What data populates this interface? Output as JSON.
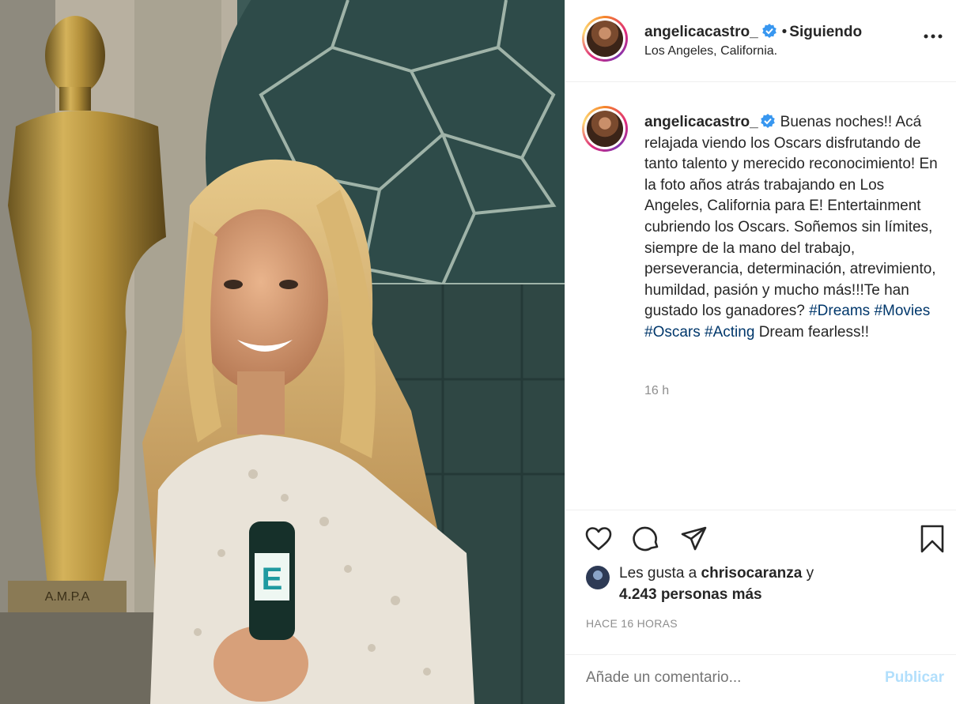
{
  "post": {
    "image_icon": "photo-woman-with-microphone-and-oscar-statue",
    "mic_badge": "E",
    "statue_plaque": "A.M.P.A"
  },
  "header": {
    "username": "angelicacastro_",
    "verified_icon": "verified-badge-icon",
    "separator": "•",
    "follow_status": "Siguiendo",
    "location": "Los Angeles, California.",
    "more_icon": "more-options-icon"
  },
  "caption": {
    "username": "angelicacastro_",
    "text_1": "Buenas noches!! Acá relajada viendo los Oscars disfrutando de tanto talento y merecido reconocimiento! En la foto años atrás trabajando en Los Angeles, California para E! Entertainment cubriendo los Oscars. Soñemos sin límites, siempre de la mano del trabajo, perseverancia, determinación, atrevimiento, humildad, pasión y mucho más!!!Te han gustado los ganadores?",
    "hashtag_1": "#Dreams",
    "hashtag_2": "#Movies",
    "hashtag_3": "#Oscars",
    "hashtag_4": "#Acting",
    "text_2": "Dream fearless!!",
    "time_ago": "16 h"
  },
  "actions": {
    "like_icon": "heart-icon",
    "comment_icon": "comment-icon",
    "share_icon": "share-icon",
    "save_icon": "bookmark-icon"
  },
  "likes": {
    "prefix": "Les gusta a",
    "liker": "chrisocaranza",
    "connector": "y",
    "others": "4.243 personas más"
  },
  "posted_time": "HACE 16 HORAS",
  "comment": {
    "placeholder": "Añade un comentario...",
    "publish_label": "Publicar"
  },
  "colors": {
    "link": "#00376b",
    "verified": "#3897f0",
    "publish_disabled": "#b2dffc",
    "muted": "#8e8e8e"
  }
}
